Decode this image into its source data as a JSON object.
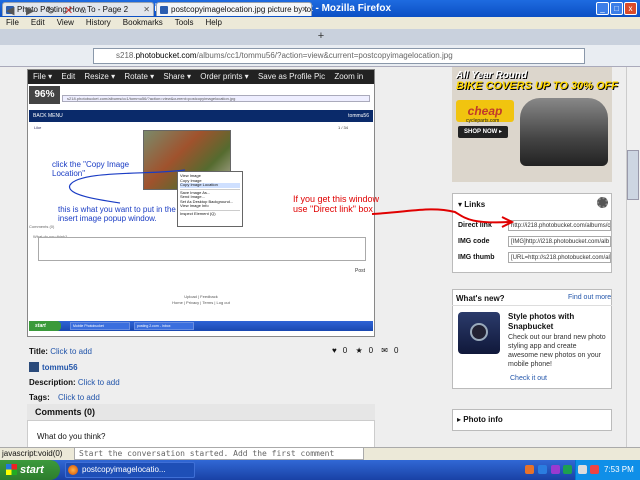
{
  "window": {
    "title": "postcopyimagelocation.jpg picture by tommu56 - Photobucket - Mozilla Firefox",
    "controls": [
      "_",
      "□",
      "x"
    ]
  },
  "menubar": [
    "File",
    "Edit",
    "View",
    "History",
    "Bookmarks",
    "Tools",
    "Help"
  ],
  "tabs": [
    {
      "label": "Photo Posting How To - Page 2",
      "active": false
    },
    {
      "label": "postcopyimagelocation.jpg picture by to...",
      "active": true
    }
  ],
  "newtab": "+",
  "url": {
    "prefix": "s218.",
    "domain": "photobucket.com",
    "path": "/albums/cc1/tommu56/?action=view&current=postcopyimagelocation.jpg"
  },
  "screenshot_toolbar": [
    "File ▾",
    "Edit",
    "Resize ▾",
    "Rotate ▾",
    "Share ▾",
    "Order prints ▾",
    "Save as Profile Pic",
    "Zoom in"
  ],
  "zoom_level": "96%",
  "inner_page": {
    "url": "s218.photobucket.com/albums/cc1/tommu56/?action=view&current=postcopyimagelocation.jpg",
    "header_left": "BACK  MENU",
    "header_right": "tommu56",
    "counter": "1 / 34",
    "like": "Like",
    "context_menu": [
      "View Image",
      "Copy Image",
      "Copy Image Location",
      "",
      "Save Image As...",
      "Send Image...",
      "Set As Desktop Background...",
      "View Image Info",
      "",
      "Inspect Element (Q)"
    ],
    "annotation_1": "click the \"Copy Image Location\"",
    "annotation_2": "this is what you want to put in the insert image popup window.",
    "comments_label": "Comments (0)",
    "what_think": "What do you think?",
    "post": "Post",
    "footer_1": "Upload | Feedback",
    "footer_2": "Home | Privacy | Terms | Log out",
    "start": "start",
    "tasks": [
      "Mobile Photobucket",
      "posting 2.com - Inbox"
    ]
  },
  "meta": {
    "title_label": "Title:",
    "title_value": "Click to add",
    "owner": "tommu56",
    "description_label": "Description:",
    "description_value": "Click to add",
    "tags_label": "Tags:",
    "tags_value": "Click to add",
    "likes": "0",
    "favorites": "0",
    "comments_count": "0"
  },
  "comments": {
    "heading": "Comments (0)",
    "prompt": "What do you think?",
    "placeholder": "Start the conversation started.  Add the first comment here..."
  },
  "ad": {
    "line1": "All Year Round",
    "line2": "BIKE COVERS UP TO 30% OFF",
    "brand": "cheap",
    "brand_sub": "cycleparts.com",
    "cta": "SHOP NOW ▸"
  },
  "links": {
    "heading": "Links",
    "rows": [
      {
        "label": "Direct link",
        "value": "http://i218.photobucket.com/albums/cc1"
      },
      {
        "label": "IMG code",
        "value": "[IMG]http://i218.photobucket.com/alb"
      },
      {
        "label": "IMG thumb",
        "value": "[URL=http://s218.photobucket.com/al"
      }
    ]
  },
  "red_annotation": "If you get this window use \"Direct  link\" box",
  "whats_new": {
    "heading": "What's new?",
    "find_out": "Find out more",
    "title": "Style photos with Snapbucket",
    "body": "Check out our brand new photo styling app and create awesome new photos on your mobile phone!",
    "link": "Check it out"
  },
  "photo_info": "Photo info",
  "statusbar": "javascript:void(0)",
  "taskbar": {
    "start": "start",
    "item": "postcopyimagelocatio...",
    "clock": "7:53 PM"
  },
  "colors": {
    "titlebar": "#0b4fc4",
    "link": "#2255aa",
    "annotation_blue": "#1a3cc4",
    "annotation_red": "#e00000",
    "taskbar": "#1941a5"
  }
}
